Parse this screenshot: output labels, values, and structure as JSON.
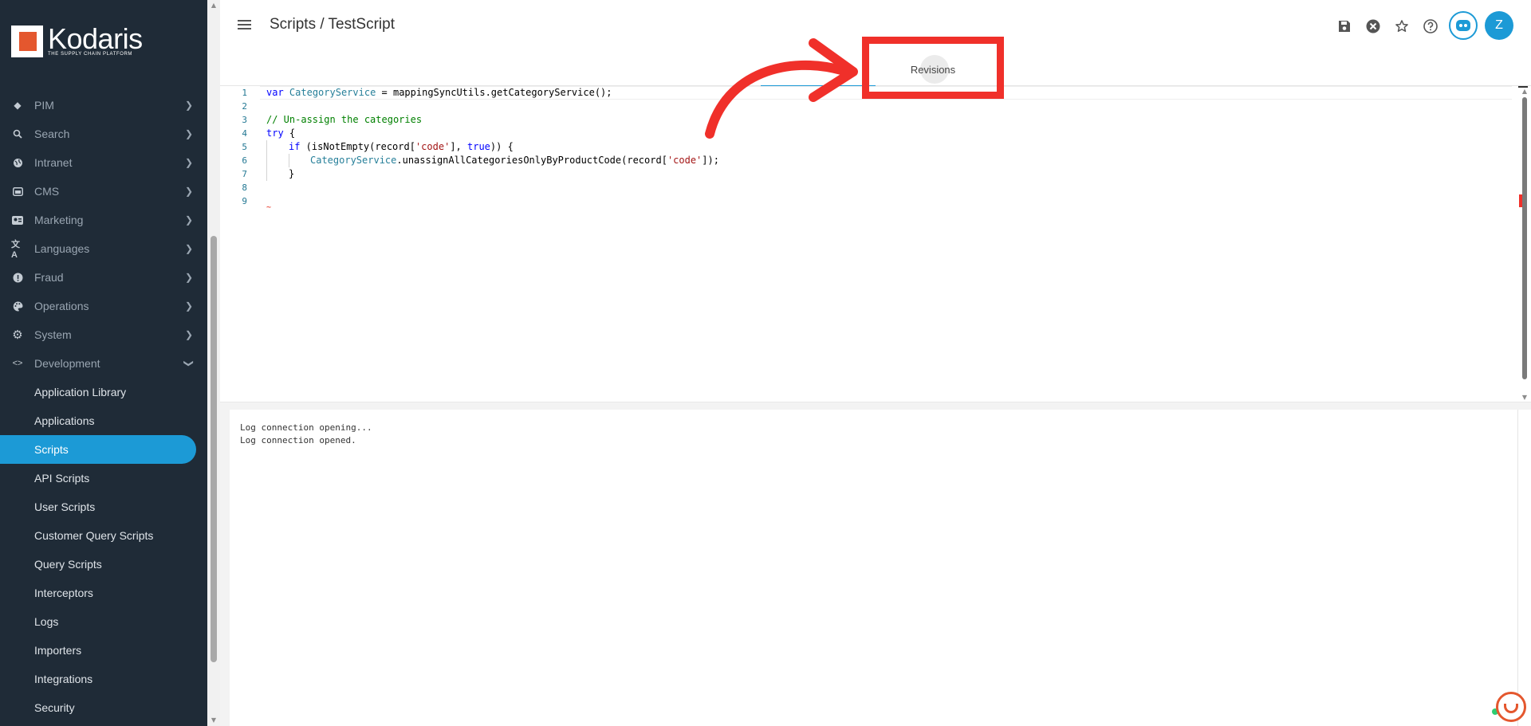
{
  "brand": {
    "name": "Kodaris",
    "tagline": "THE SUPPLY CHAIN PLATFORM"
  },
  "header": {
    "title": "Scripts / TestScript",
    "avatar_initial": "Z"
  },
  "tabs": [
    {
      "label": ""
    },
    {
      "label": "Revisions"
    }
  ],
  "nav": {
    "items": [
      {
        "label": "PIM",
        "icon": "tag-icon"
      },
      {
        "label": "Search",
        "icon": "search-icon"
      },
      {
        "label": "Intranet",
        "icon": "globe-icon"
      },
      {
        "label": "CMS",
        "icon": "browser-icon"
      },
      {
        "label": "Marketing",
        "icon": "id-card-icon"
      },
      {
        "label": "Languages",
        "icon": "translate-icon"
      },
      {
        "label": "Fraud",
        "icon": "alert-icon"
      },
      {
        "label": "Operations",
        "icon": "palette-icon"
      },
      {
        "label": "System",
        "icon": "gear-icon"
      },
      {
        "label": "Development",
        "icon": "code-icon"
      }
    ],
    "development_children": [
      "Application Library",
      "Applications",
      "Scripts",
      "API Scripts",
      "User Scripts",
      "Customer Query Scripts",
      "Query Scripts",
      "Interceptors",
      "Logs",
      "Importers",
      "Integrations",
      "Security"
    ],
    "active_child": "Scripts"
  },
  "editor": {
    "line_numbers": [
      "1",
      "2",
      "3",
      "4",
      "5",
      "6",
      "7",
      "8",
      "9"
    ],
    "code": {
      "l1_kw": "var",
      "l1_cls": "CategoryService",
      "l1_rest": " = mappingSyncUtils.getCategoryService();",
      "l3_cmt": "// Un-assign the categories",
      "l4_kw": "try",
      "l4_rest": " {",
      "l5_kw1": "if",
      "l5_a": " (isNotEmpty(record[",
      "l5_str": "'code'",
      "l5_b": "], ",
      "l5_kw2": "true",
      "l5_c": ")) {",
      "l6_cls": "CategoryService",
      "l6_a": ".unassignAllCategoriesOnlyByProductCode(record[",
      "l6_str": "'code'",
      "l6_b": "]);",
      "l7": "}",
      "l9_squiggle": "~"
    }
  },
  "log": {
    "lines": [
      "Log connection opening...",
      "Log connection opened."
    ]
  },
  "colors": {
    "accent": "#1c9ad6",
    "sidebar_bg": "#1f2b37",
    "annotation": "#f0302a",
    "brand_orange": "#e4572e"
  }
}
